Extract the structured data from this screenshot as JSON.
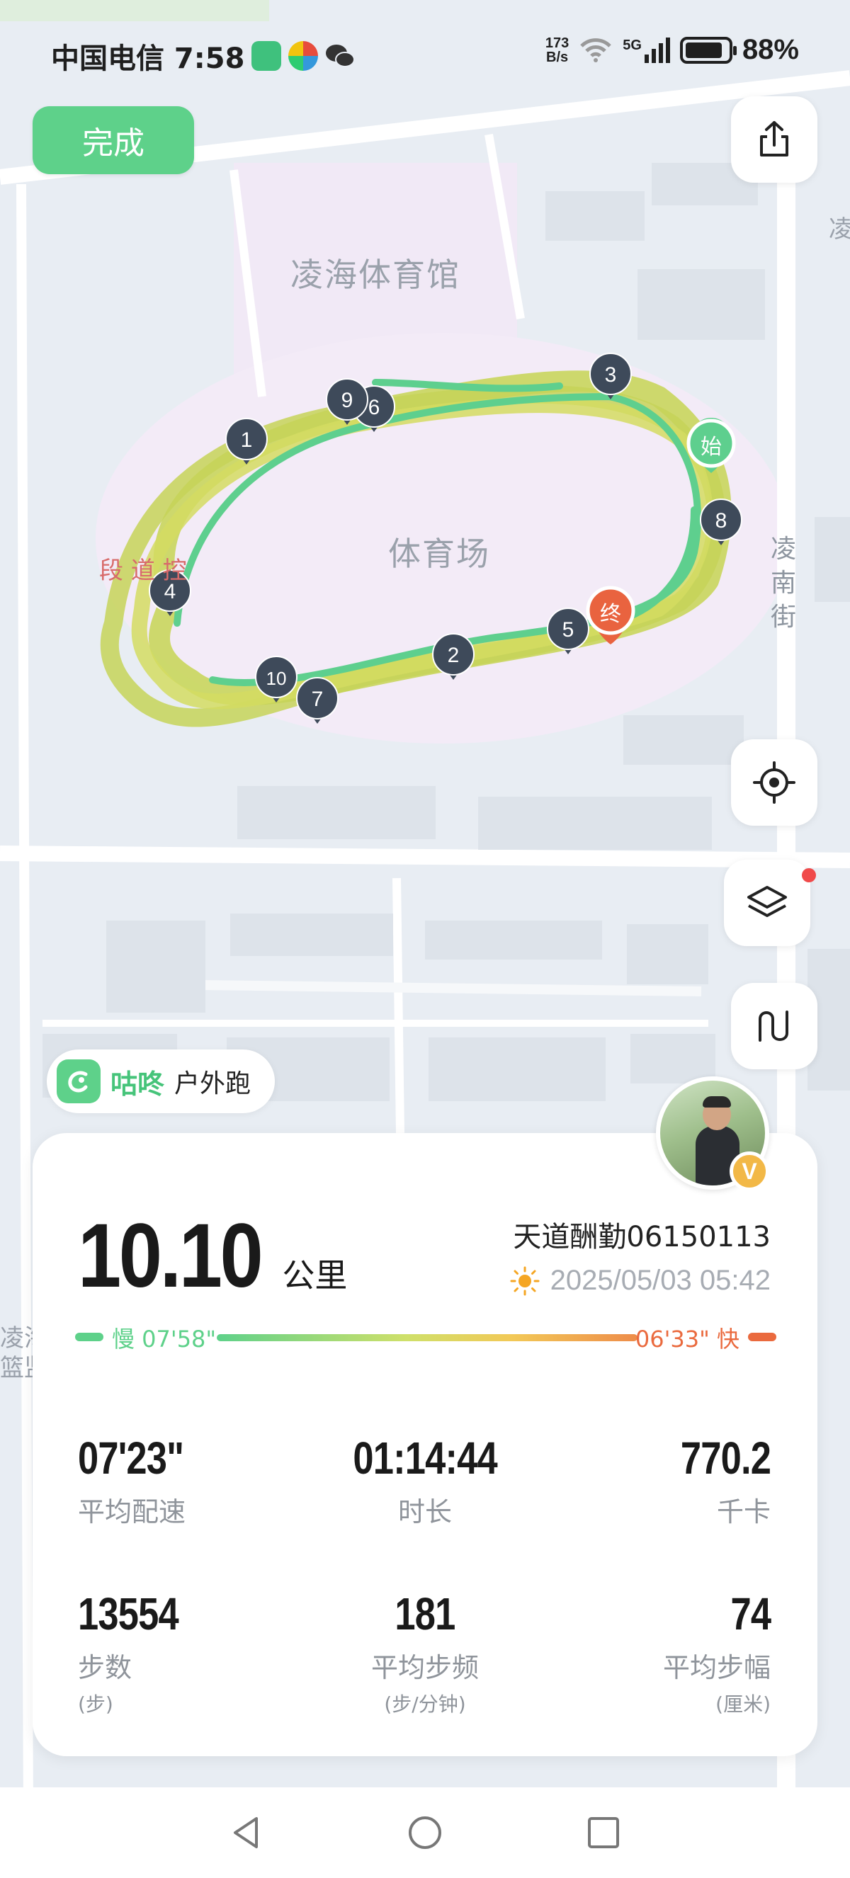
{
  "status_bar": {
    "carrier_time": "中国电信 7:58",
    "net_speed_value": "173",
    "net_speed_unit": "B/s",
    "network": "5G",
    "battery": "88%",
    "battery_level": 0.88
  },
  "toolbar": {
    "done_label": "完成",
    "share_icon": "share-icon",
    "locate_icon": "locate-icon",
    "layers_icon": "layers-icon",
    "route_icon": "route-icon"
  },
  "map": {
    "labels": {
      "gym": "凌海体育馆",
      "stadium": "体育场",
      "street": "凌南街",
      "segment": "段 道 控",
      "edge_top": "凌",
      "edge_left_1": "凌海",
      "edge_left_2": "篮监"
    },
    "start_label": "始",
    "end_label": "终",
    "km_markers": [
      "1",
      "2",
      "3",
      "4",
      "5",
      "6",
      "7",
      "8",
      "9",
      "10"
    ],
    "route_colors": {
      "slow": "#5ed18a",
      "medium": "#c8d65a",
      "fast": "#ea6a3e"
    }
  },
  "badge": {
    "brand": "咕咚",
    "activity_type": "户外跑"
  },
  "summary": {
    "distance_value": "10.10",
    "distance_unit": "公里",
    "username": "天道酬勤06150113",
    "datetime": "2025/05/03 05:42",
    "weather_icon": "sun-icon",
    "pace_slow": "慢 07'58\"",
    "pace_fast": "06'33\" 快"
  },
  "stats": [
    {
      "value": "07'23\"",
      "label": "平均配速",
      "sub": ""
    },
    {
      "value": "01:14:44",
      "label": "时长",
      "sub": ""
    },
    {
      "value": "770.2",
      "label": "千卡",
      "sub": ""
    },
    {
      "value": "13554",
      "label": "步数",
      "sub": "(步)"
    },
    {
      "value": "181",
      "label": "平均步频",
      "sub": "(步/分钟)"
    },
    {
      "value": "74",
      "label": "平均步幅",
      "sub": "(厘米)"
    }
  ],
  "avatar_badge": "V",
  "nav": {
    "back": "back-icon",
    "home": "home-icon",
    "recents": "recents-icon"
  },
  "colors": {
    "accent": "#5ed18a",
    "fast": "#ea6a3e",
    "marker": "#3e4a5a"
  }
}
